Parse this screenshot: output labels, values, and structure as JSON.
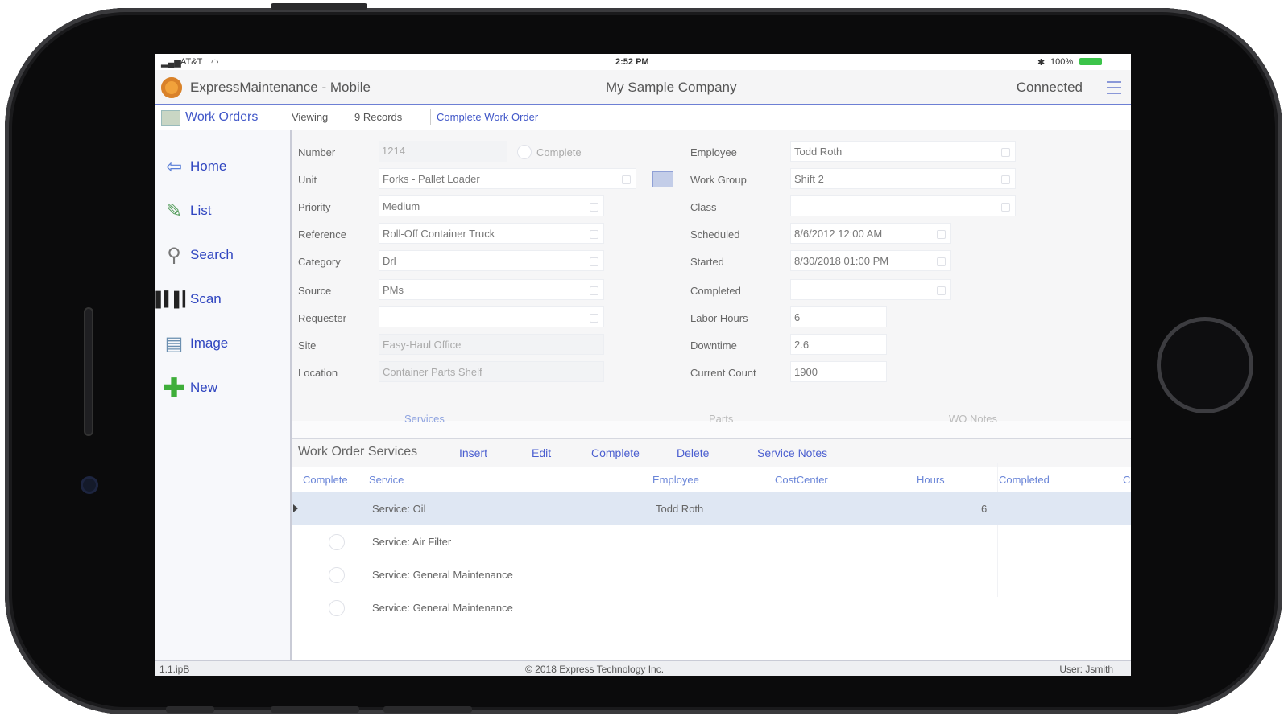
{
  "status_bar": {
    "carrier": "AT&T",
    "time": "2:52 PM",
    "battery": "100%"
  },
  "app": {
    "title": "ExpressMaintenance - Mobile",
    "company": "My Sample Company",
    "connection": "Connected"
  },
  "subnav": {
    "module": "Work Orders",
    "viewing": "Viewing",
    "records": "9 Records",
    "action": "Complete Work Order"
  },
  "sidebar": {
    "items": [
      {
        "label": "Home",
        "icon": "home-arrow-icon"
      },
      {
        "label": "List",
        "icon": "list-icon"
      },
      {
        "label": "Search",
        "icon": "search-icon"
      },
      {
        "label": "Scan",
        "icon": "barcode-icon"
      },
      {
        "label": "Image",
        "icon": "image-icon"
      },
      {
        "label": "New",
        "icon": "plus-icon"
      }
    ]
  },
  "form": {
    "left": [
      {
        "label": "Number",
        "value": "1214",
        "readonly": true
      },
      {
        "label": "Unit",
        "value": "Forks - Pallet Loader"
      },
      {
        "label": "Priority",
        "value": "Medium"
      },
      {
        "label": "Reference",
        "value": "Roll-Off Container Truck"
      },
      {
        "label": "Category",
        "value": "Drl"
      },
      {
        "label": "Source",
        "value": "PMs"
      },
      {
        "label": "Requester",
        "value": ""
      },
      {
        "label": "Site",
        "value": "Easy-Haul Office",
        "readonly": true
      },
      {
        "label": "Location",
        "value": "Container Parts Shelf",
        "readonly": true
      }
    ],
    "complete_label": "Complete",
    "right": [
      {
        "label": "Employee",
        "value": "Todd Roth"
      },
      {
        "label": "Work Group",
        "value": "Shift 2"
      },
      {
        "label": "Class",
        "value": ""
      },
      {
        "label": "Scheduled",
        "value": "8/6/2012 12:00 AM"
      },
      {
        "label": "Started",
        "value": "8/30/2018 01:00 PM"
      },
      {
        "label": "Completed",
        "value": ""
      },
      {
        "label": "Labor Hours",
        "value": "6"
      },
      {
        "label": "Downtime",
        "value": "2.6"
      },
      {
        "label": "Current Count",
        "value": "1900"
      }
    ]
  },
  "tabs": [
    "Services",
    "Parts",
    "WO Notes"
  ],
  "grid": {
    "title": "Work Order Services",
    "actions": [
      "Insert",
      "Edit",
      "Complete",
      "Delete",
      "Service Notes"
    ],
    "columns": [
      "Complete",
      "Service",
      "Employee",
      "CostCenter",
      "Hours",
      "Completed",
      "C"
    ],
    "rows": [
      {
        "service": "Service: Oil",
        "employee": "Todd Roth",
        "hours": "6",
        "selected": true
      },
      {
        "service": "Service: Air Filter",
        "employee": "",
        "hours": ""
      },
      {
        "service": "Service: General Maintenance",
        "employee": "",
        "hours": ""
      },
      {
        "service": "Service: General Maintenance",
        "employee": "",
        "hours": ""
      }
    ]
  },
  "footer": {
    "version": "1.1.ipB",
    "copyright": "© 2018 Express Technology Inc.",
    "user": "User: Jsmith"
  }
}
